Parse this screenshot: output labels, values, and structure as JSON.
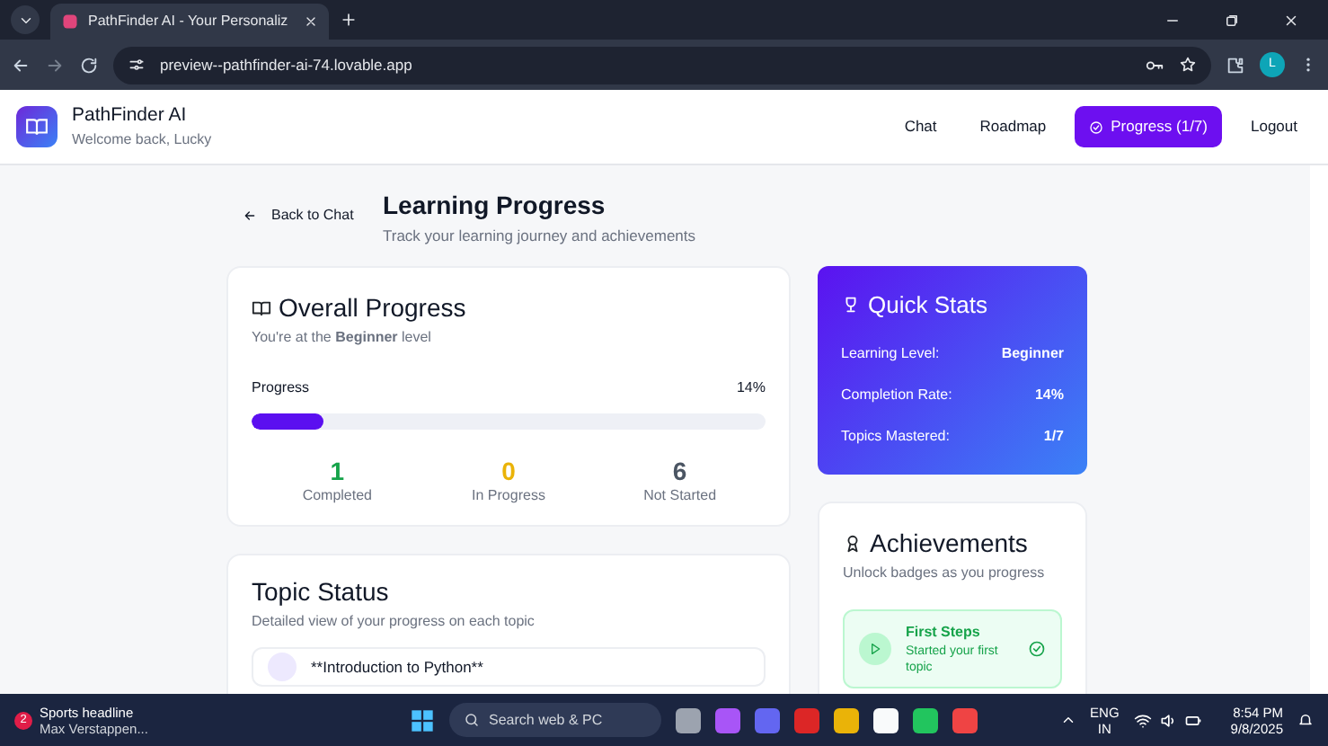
{
  "browser": {
    "tab_title": "PathFinder AI - Your Personaliz",
    "url": "preview--pathfinder-ai-74.lovable.app",
    "profile_initial": "L"
  },
  "header": {
    "app_name": "PathFinder AI",
    "subtitle": "Welcome back, Lucky",
    "nav": [
      {
        "label": "Chat",
        "selected": false
      },
      {
        "label": "Roadmap",
        "selected": false
      },
      {
        "label": "Progress (1/7)",
        "selected": true
      },
      {
        "label": "Logout",
        "selected": false
      }
    ]
  },
  "back_link": "Back to Chat",
  "page_title": "Learning Progress",
  "page_subtitle": "Track your learning journey and achievements",
  "overall": {
    "title": "Overall Progress",
    "subtitle": "You're at the **Beginner** level",
    "progress_label": "Progress",
    "progress_value": "14%",
    "level": 0.14,
    "stats": [
      {
        "value": "1",
        "label": "Completed",
        "color": "#16a34a"
      },
      {
        "value": "0",
        "label": "In Progress",
        "color": "#eab308"
      },
      {
        "value": "6",
        "label": "Not Started",
        "color": "#4b5563"
      }
    ]
  },
  "topic_status": {
    "title": "Topic Status",
    "subtitle": "Detailed view of your progress on each topic",
    "topics": [
      {
        "title": "**Introduction to Python**"
      }
    ]
  },
  "quick_stats": {
    "title": "Quick Stats",
    "rows": [
      {
        "label": "Learning Level:",
        "value": "Beginner"
      },
      {
        "label": "Completion Rate:",
        "value": "14%"
      },
      {
        "label": "Topics Mastered:",
        "value": "1/7"
      }
    ]
  },
  "achievements": {
    "title": "Achievements",
    "subtitle": "Unlock badges as you progress",
    "items": [
      {
        "title": "First Steps",
        "description": "Started your first topic",
        "unlocked": true
      }
    ]
  },
  "taskbar": {
    "news_badge": "2",
    "news_title": "Sports headline",
    "news_text": "Max Verstappen...",
    "search_placeholder": "Search web & PC",
    "language": "ENG",
    "region": "IN",
    "time": "8:54 PM",
    "date": "9/8/2025"
  }
}
